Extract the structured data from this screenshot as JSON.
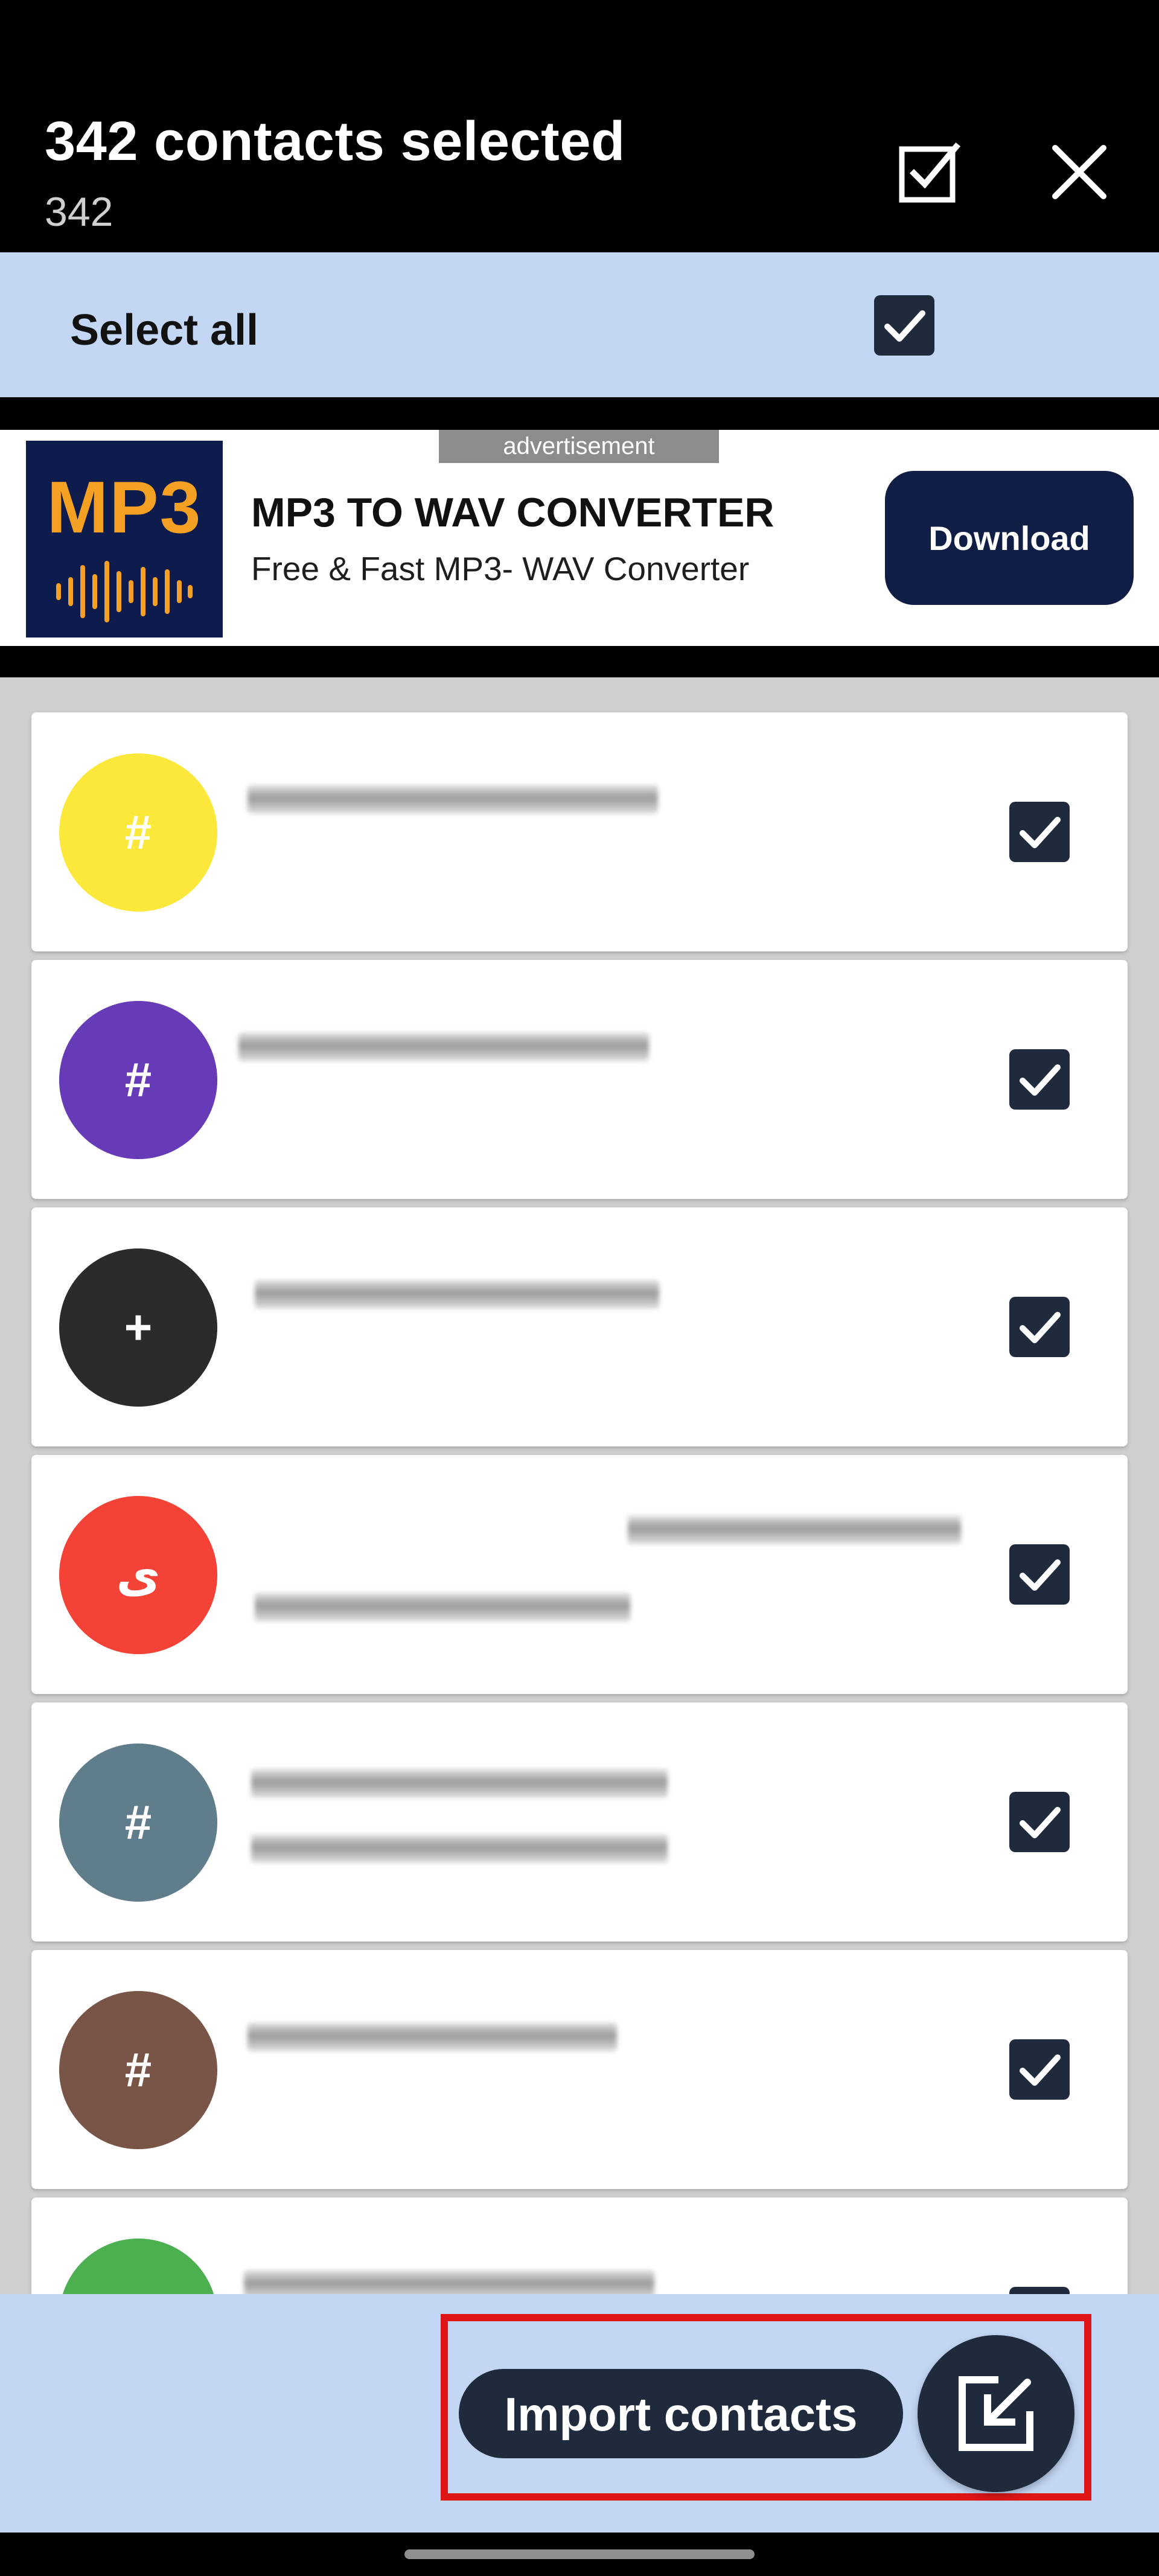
{
  "header": {
    "title": "342 contacts selected",
    "count": "342",
    "select_icon": "checkbox-select-icon",
    "close_icon": "close-icon"
  },
  "select_all": {
    "label": "Select all",
    "checked": true
  },
  "ad": {
    "tag": "advertisement",
    "logo_text": "MP3",
    "title": "MP3 TO WAV CONVERTER",
    "subtitle": "Free & Fast MP3- WAV Converter",
    "button_label": "Download",
    "logo_bg": "#0d1b4d",
    "logo_accent": "#f4a022"
  },
  "contacts": [
    {
      "initial": "#",
      "color": "#fbe83a",
      "checked": true
    },
    {
      "initial": "#",
      "color": "#673bb7",
      "checked": true
    },
    {
      "initial": "+",
      "color": "#2b2b2b",
      "checked": true
    },
    {
      "initial": "ى",
      "color": "#f44236",
      "checked": true
    },
    {
      "initial": "#",
      "color": "#607d8b",
      "checked": true
    },
    {
      "initial": "#",
      "color": "#795548",
      "checked": true
    },
    {
      "initial": "",
      "color": "#4caf50",
      "checked": true
    }
  ],
  "bottom": {
    "import_label": "Import contacts",
    "fab_icon": "import-edit-icon"
  },
  "colors": {
    "accent_band": "#c3d7f4",
    "button_dark": "#1f2b3d",
    "highlight": "#e01616"
  }
}
